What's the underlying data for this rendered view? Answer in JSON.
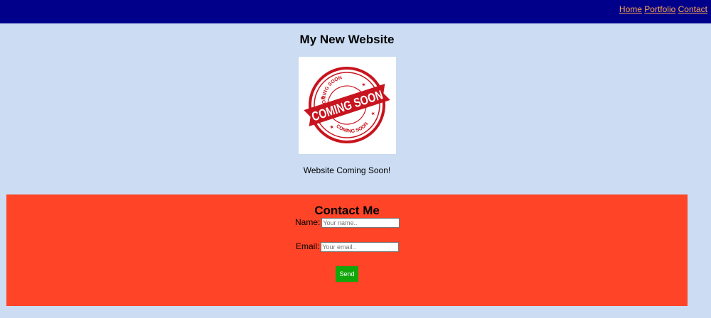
{
  "nav": {
    "home": "Home",
    "portfolio": "Portfolio",
    "contact": "Contact"
  },
  "page_title": "My New Website",
  "hero": {
    "stamp_top_text": "COMING SOON",
    "stamp_main_text": "COMING SOON",
    "stamp_bottom_text": "COMING SOON"
  },
  "coming_soon_text": "Website Coming Soon!",
  "contact": {
    "title": "Contact Me",
    "name_label": "Name:",
    "name_placeholder": "Your name..",
    "email_label": "Email:",
    "email_placeholder": "Your email..",
    "send_label": "Send"
  },
  "colors": {
    "header_bg": "#00008b",
    "page_bg": "#cbdcf3",
    "nav_link": "#ffa64d",
    "contact_bg": "#ff4427",
    "send_bg": "#11a70a",
    "stamp_red": "#c8141e"
  }
}
